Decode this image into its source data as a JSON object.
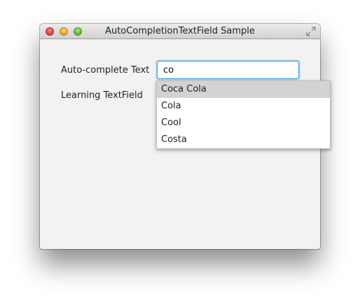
{
  "window": {
    "title": "AutoCompletionTextField Sample"
  },
  "form": {
    "autocomplete_label": "Auto-complete Text",
    "autocomplete_value": "co",
    "learning_label": "Learning TextField"
  },
  "suggestions": {
    "selected_index": 0,
    "items": [
      {
        "label": "Coca Cola"
      },
      {
        "label": "Cola"
      },
      {
        "label": "Cool"
      },
      {
        "label": "Costa"
      }
    ]
  },
  "icons": {
    "close": "close-traffic-light-icon",
    "minimize": "minimize-traffic-light-icon",
    "zoom": "zoom-traffic-light-icon",
    "fullscreen": "fullscreen-icon"
  },
  "colors": {
    "focus_border": "#3c9ee0",
    "selection": "#d3d3d3",
    "close": "#e0443e",
    "minimize": "#e9a91f",
    "zoom": "#5fbd39"
  }
}
